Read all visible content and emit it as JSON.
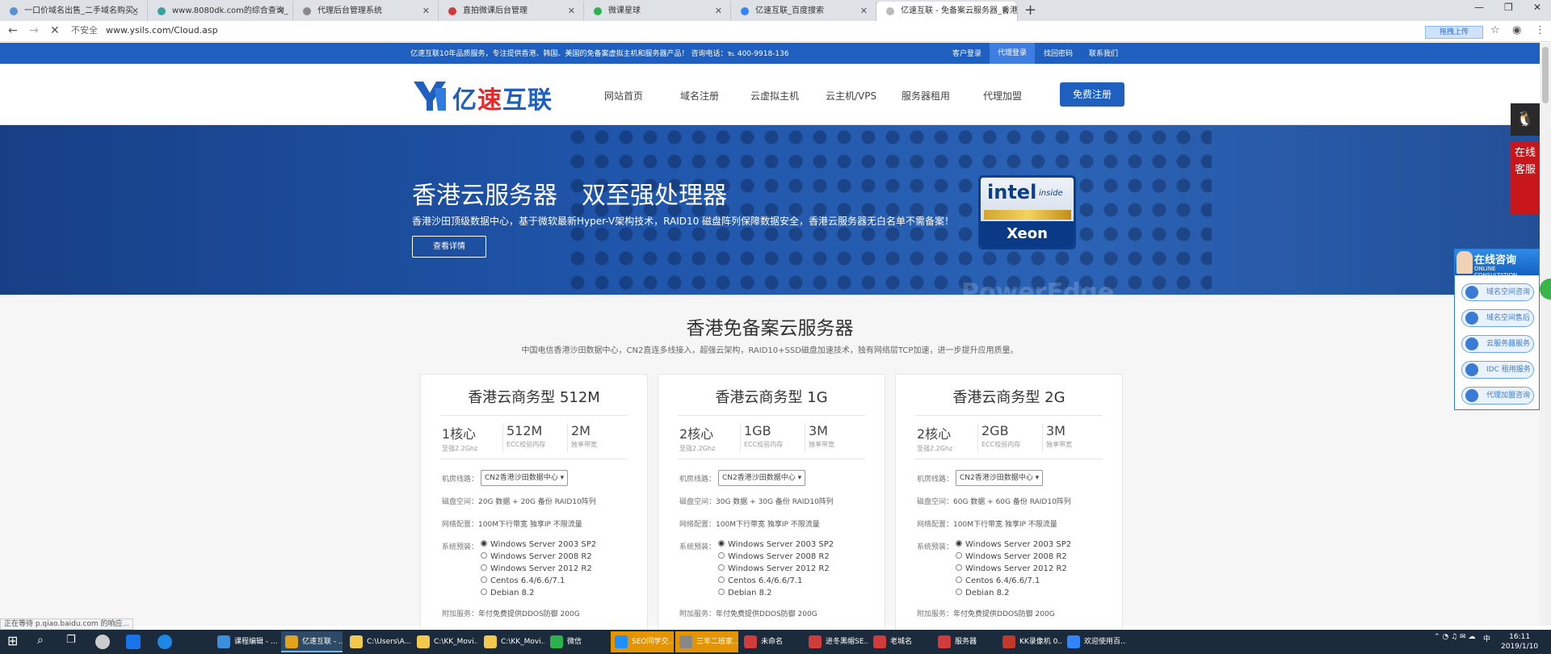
{
  "browser": {
    "tabs": [
      {
        "label": "一口价域名出售_二手域名购买_",
        "color": "#5b8fd8"
      },
      {
        "label": "www.8080dk.com的综合查询_",
        "color": "#3aa1a1"
      },
      {
        "label": "代理后台管理系统",
        "color": "#888888"
      },
      {
        "label": "直拍微课后台管理",
        "color": "#d23b3b"
      },
      {
        "label": "微课星球",
        "color": "#2bb24c"
      },
      {
        "label": "亿速互联_百度搜索",
        "color": "#3385ff"
      },
      {
        "label": "亿速互联 - 免备案云服务器_香港",
        "color": "#888888"
      }
    ],
    "new_tab": "+",
    "insecure_label": "不安全",
    "url": "www.ysils.com/Cloud.asp",
    "upload_label": "拖拽上传",
    "status_text": "正在等待 p.qiao.baidu.com 的响应..."
  },
  "topbar": {
    "notice": "亿速互联10年品质服务，专注提供香港、韩国、美国的免备案虚拟主机和服务器产品！ 咨询电话：℡ 400-9918-136",
    "links": [
      "客户登录",
      "代理登录",
      "找回密码",
      "联系我们"
    ]
  },
  "header": {
    "logo_text_a": "亿",
    "logo_text_b": "速",
    "logo_text_c": "互联",
    "nav": [
      "网站首页",
      "域名注册",
      "云虚拟主机",
      "云主机/VPS",
      "服务器租用",
      "代理加盟"
    ],
    "register": "免费注册"
  },
  "banner": {
    "title": "香港云服务器　双至强处理器",
    "subtitle": "香港沙田顶级数据中心，基于微软最新Hyper-V架构技术，RAID10 磁盘阵列保障数据安全，香港云服务器无白名单不需备案！",
    "button": "查看详情",
    "intel_a": "intel",
    "intel_b": "inside",
    "intel_c": "Xeon",
    "ghost": "PowerEdge"
  },
  "section": {
    "title": "香港免备案云服务器",
    "subtitle": "中国电信香港沙田数据中心，CN2直连多线接入，超强云架构，RAID10+SSD磁盘加速技术，独有网络层TCP加速，进一步提升应用质量。"
  },
  "cards": [
    {
      "title": "香港云商务型 512M",
      "specs": [
        {
          "big": "1核心",
          "sm": "至强2.2Ghz"
        },
        {
          "big": "512M",
          "sm": "ECC校验内存"
        },
        {
          "big": "2M",
          "sm": "独享带宽"
        }
      ],
      "line_label": "机房线路：",
      "line_value": "CN2香港沙田数据中心",
      "disk_label": "磁盘空间：",
      "disk_value": "20G 数据 + 20G 备份 RAID10阵列",
      "net_label": "网络配置：",
      "net_value": "100M下行带宽 独享IP 不限流量",
      "os_label": "系统预装：",
      "os": [
        "Windows Server 2003 SP2",
        "Windows Server 2008 R2",
        "Windows Server 2012 R2",
        "Centos 6.4/6.6/7.1",
        "Debian 8.2"
      ],
      "extra_label": "附加服务：",
      "extra_value": "年付免费提供DDOS防御 200G"
    },
    {
      "title": "香港云商务型 1G",
      "specs": [
        {
          "big": "2核心",
          "sm": "至强2.2Ghz"
        },
        {
          "big": "1GB",
          "sm": "ECC校验内存"
        },
        {
          "big": "3M",
          "sm": "独享带宽"
        }
      ],
      "line_label": "机房线路：",
      "line_value": "CN2香港沙田数据中心",
      "disk_label": "磁盘空间：",
      "disk_value": "30G 数据 + 30G 备份 RAID10阵列",
      "net_label": "网络配置：",
      "net_value": "100M下行带宽 独享IP 不限流量",
      "os_label": "系统预装：",
      "os": [
        "Windows Server 2003 SP2",
        "Windows Server 2008 R2",
        "Windows Server 2012 R2",
        "Centos 6.4/6.6/7.1",
        "Debian 8.2"
      ],
      "extra_label": "附加服务：",
      "extra_value": "年付免费提供DDOS防御 200G"
    },
    {
      "title": "香港云商务型 2G",
      "specs": [
        {
          "big": "2核心",
          "sm": "至强2.2Ghz"
        },
        {
          "big": "2GB",
          "sm": "ECC校验内存"
        },
        {
          "big": "3M",
          "sm": "独享带宽"
        }
      ],
      "line_label": "机房线路：",
      "line_value": "CN2香港沙田数据中心",
      "disk_label": "磁盘空间：",
      "disk_value": "60G 数据 + 60G 备份 RAID10阵列",
      "net_label": "网络配置：",
      "net_value": "100M下行带宽 独享IP 不限流量",
      "os_label": "系统预装：",
      "os": [
        "Windows Server 2003 SP2",
        "Windows Server 2008 R2",
        "Windows Server 2012 R2",
        "Centos 6.4/6.6/7.1",
        "Debian 8.2"
      ],
      "extra_label": "附加服务：",
      "extra_value": "年付免费提供DDOS防御 200G"
    }
  ],
  "float": {
    "online_service": "在线客服",
    "consult_title": "在线咨询",
    "consult_sub": "ONLINE CONSULTATION",
    "consult_items": [
      "域名空间咨询",
      "域名空间售后",
      "云服务器服务",
      "IDC 租用服务",
      "代理加盟咨询"
    ]
  },
  "taskbar": {
    "apps": [
      {
        "label": "课程编辑 - ...",
        "color": "#3b8fdc"
      },
      {
        "label": "亿速互联 - ...",
        "color": "#e0a21f"
      },
      {
        "label": "C:\\Users\\A...",
        "color": "#f2c94c"
      },
      {
        "label": "C:\\KK_Movi...",
        "color": "#f2c94c"
      },
      {
        "label": "C:\\KK_Movi...",
        "color": "#f2c94c"
      },
      {
        "label": "微信",
        "color": "#2bb24c"
      },
      {
        "label": "SEO同学交...",
        "color": "#1e90ff"
      },
      {
        "label": "三年二班家...",
        "color": "#888888"
      },
      {
        "label": "未命名",
        "color": "#d23b3b"
      },
      {
        "label": "进冬黑帽SE...",
        "color": "#d23b3b"
      },
      {
        "label": "老城名",
        "color": "#d23b3b"
      },
      {
        "label": "服务器",
        "color": "#d23b3b"
      },
      {
        "label": "KK录像机 0...",
        "color": "#c0392b"
      },
      {
        "label": "欢迎使用百...",
        "color": "#3385ff"
      }
    ],
    "ime": "中",
    "time": "16:11",
    "date": "2019/1/10"
  }
}
